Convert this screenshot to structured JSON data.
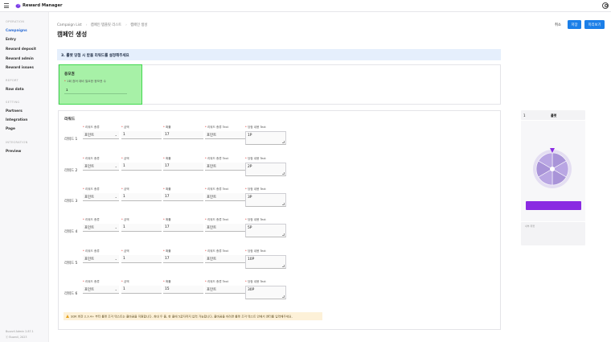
{
  "app": {
    "title": "Reward Manager",
    "brand_color": "#7b3fe4"
  },
  "header": {
    "menu_icon": "hamburger-icon",
    "user_icon": "user-circle-icon"
  },
  "sidebar": {
    "sections": [
      {
        "title": "OPERATION",
        "items": [
          "Campaigns",
          "Entry",
          "Reward deposit",
          "Reward admin",
          "Reward issues"
        ]
      },
      {
        "title": "REPORT",
        "items": [
          "Raw data"
        ]
      },
      {
        "title": "SETTING",
        "items": [
          "Partners",
          "Integration",
          "Page"
        ]
      },
      {
        "title": "INTEGRATION",
        "items": [
          "Preview"
        ]
      }
    ],
    "active": "Campaigns",
    "footer": {
      "version": "Buzzvil Admin 2.87.1",
      "copyright": "ⓒ Buzzvil, 2023"
    }
  },
  "breadcrumb": [
    "Campaign List",
    "캠페인 템플릿 리스트",
    "캠페인 생성"
  ],
  "page_title": "캠페인 생성",
  "actions": {
    "cancel": "취소",
    "save": "저장",
    "preview": "미리보기",
    "accent": "#1b7fe8"
  },
  "step": {
    "title": "3. 룰렛 당첨 시 받을 리워드를 설정해주세요"
  },
  "condition": {
    "title": "응모권",
    "label": "1회 참여 대비 필요한 응모권 수",
    "value": "1",
    "highlight": "#a7f1a7"
  },
  "rewards": {
    "title": "리워드",
    "field_labels": {
      "type": "리워드 종류",
      "amount": "금액",
      "probability": "확률",
      "type_text": "리워드 종류 Text",
      "win_text": "당첨 내용 Text"
    },
    "rows": [
      {
        "label": "리워드 1",
        "type": "포인트",
        "amount": "1",
        "probability": "17",
        "type_text": "포인트",
        "win_text": "1P"
      },
      {
        "label": "리워드 2",
        "type": "포인트",
        "amount": "1",
        "probability": "17",
        "type_text": "포인트",
        "win_text": "2P"
      },
      {
        "label": "리워드 3",
        "type": "포인트",
        "amount": "1",
        "probability": "17",
        "type_text": "포인트",
        "win_text": "3P"
      },
      {
        "label": "리워드 4",
        "type": "포인트",
        "amount": "1",
        "probability": "17",
        "type_text": "포인트",
        "win_text": "5P"
      },
      {
        "label": "리워드 5",
        "type": "포인트",
        "amount": "1",
        "probability": "17",
        "type_text": "포인트",
        "win_text": "10P"
      },
      {
        "label": "리워드 6",
        "type": "포인트",
        "amount": "1",
        "probability": "15",
        "type_text": "포인트",
        "win_text": "30P"
      }
    ],
    "warning": "SDK 버전 2.3.4+ 부터 룰렛 조각 텍스트는 줄바꿈을 지원합니다. 최대 두 줄, 한 줄에 5글자까지 입력 가능합니다. 줄바꿈을 하려면 룰렛 조각 텍스트 안에서 엔터를 입력해주세요."
  },
  "preview": {
    "index": "1",
    "label": "룰렛",
    "box_hint": "내부 위젯",
    "wheel_color": "#b9a6e3",
    "pointer_color": "#8a2be2",
    "spin_button_color": "#8a2be2"
  }
}
